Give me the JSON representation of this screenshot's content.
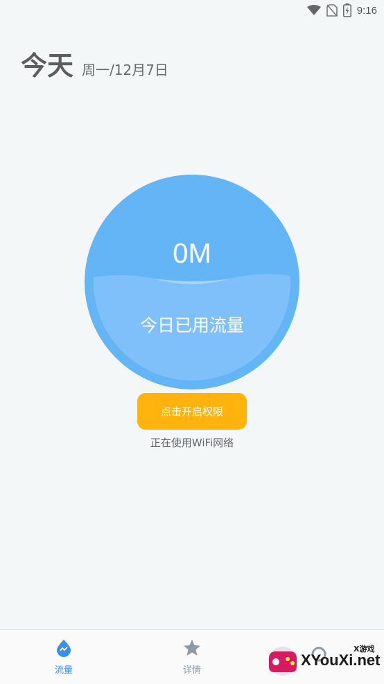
{
  "status_bar": {
    "time": "9:16",
    "icons": [
      "wifi-icon",
      "no-sim-icon",
      "battery-icon"
    ]
  },
  "header": {
    "title": "今天",
    "date": "周一/12月7日"
  },
  "gauge": {
    "value": "0M",
    "label": "今日已用流量",
    "colors": {
      "outer": "#64b5f6",
      "water": "#82c2f9",
      "wave": "#a9d4fb"
    }
  },
  "permission_button": {
    "label": "点击开启权限",
    "color": "#ffb30c"
  },
  "network_status": "正在使用WiFi网络",
  "bottom_nav": {
    "items": [
      {
        "label": "流量",
        "icon": "water-drop-icon",
        "active": true
      },
      {
        "label": "详情",
        "icon": "star-icon",
        "active": false
      },
      {
        "label": "",
        "icon": "settings-icon",
        "active": false
      }
    ],
    "active_color": "#3a8ee6",
    "inactive_color": "#8b9aa5"
  },
  "watermark": {
    "text": "XYouXi.net",
    "sub": "X游戏"
  }
}
